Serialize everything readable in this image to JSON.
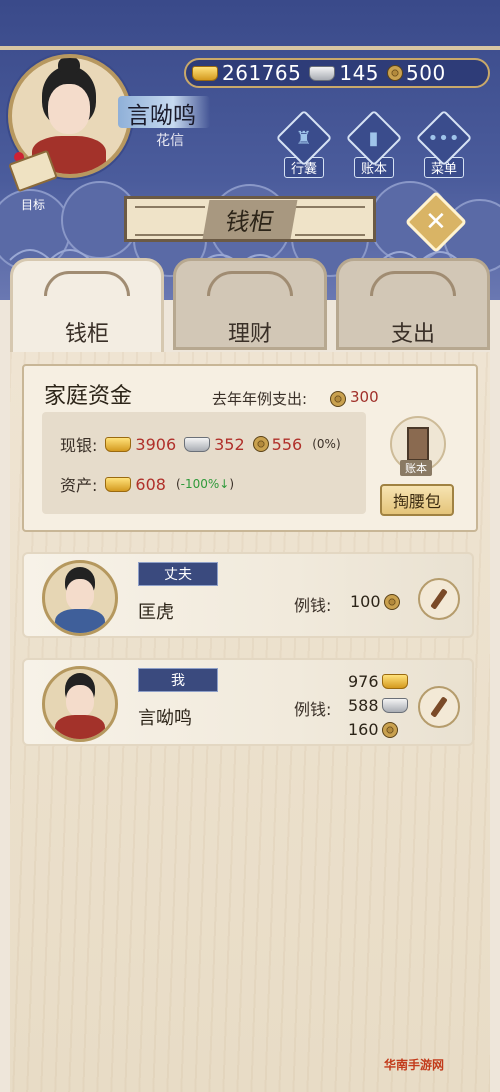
{
  "header": {
    "currency": {
      "gold": "261765",
      "silver": "145",
      "copper": "500"
    },
    "player": {
      "name": "言呦鸣",
      "title": "花信"
    },
    "goal_label": "目标",
    "buttons": [
      {
        "label": "行囊",
        "icon": "bag-icon"
      },
      {
        "label": "账本",
        "icon": "ledger-icon"
      },
      {
        "label": "菜单",
        "icon": "menu-dots-icon"
      }
    ]
  },
  "page_title": "钱柜",
  "tabs": [
    {
      "label": "钱柜",
      "active": true
    },
    {
      "label": "理财",
      "active": false
    },
    {
      "label": "支出",
      "active": false
    }
  ],
  "funds": {
    "title": "家庭资金",
    "yearly_label": "去年年例支出:",
    "yearly_value": "300",
    "cash_label": "现银:",
    "cash_gold": "3906",
    "cash_silver": "352",
    "cash_copper": "556",
    "cash_pct": "(0%)",
    "assets_label": "资产:",
    "assets_gold": "608",
    "assets_pct": "-100%",
    "ledger_tag": "账本",
    "pocket_button": "掏腰包"
  },
  "members": [
    {
      "role": "丈夫",
      "name": "匡虎",
      "allowance_label": "例钱:",
      "allowance": [
        "100"
      ]
    },
    {
      "role": "我",
      "name": "言呦鸣",
      "allowance_label": "例钱:",
      "allowance": [
        "976",
        "588",
        "160"
      ]
    }
  ],
  "watermark": "华南手游网"
}
